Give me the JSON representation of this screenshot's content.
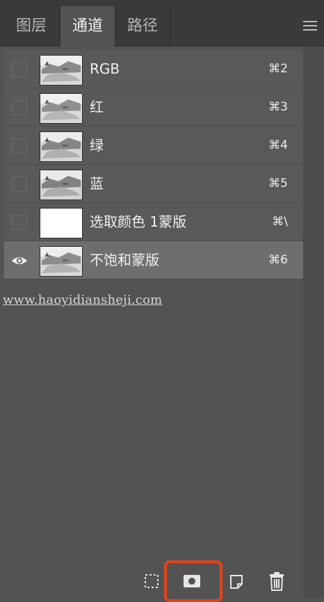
{
  "tabs": [
    {
      "label": "图层",
      "active": false
    },
    {
      "label": "通道",
      "active": true
    },
    {
      "label": "路径",
      "active": false
    }
  ],
  "panel_menu_icon": "hamburger-menu-icon",
  "channels": [
    {
      "name": "RGB",
      "shortcut": "⌘2",
      "visible": false,
      "thumb": "photo"
    },
    {
      "name": "红",
      "shortcut": "⌘3",
      "visible": false,
      "thumb": "photo"
    },
    {
      "name": "绿",
      "shortcut": "⌘4",
      "visible": false,
      "thumb": "photo"
    },
    {
      "name": "蓝",
      "shortcut": "⌘5",
      "visible": false,
      "thumb": "photo"
    },
    {
      "name": "选取颜色 1蒙版",
      "shortcut": "⌘\\",
      "visible": false,
      "thumb": "white"
    },
    {
      "name": "不饱和蒙版",
      "shortcut": "⌘6",
      "visible": true,
      "thumb": "photo",
      "selected": true
    }
  ],
  "watermark": "www.haoyidiansheji.com",
  "toolbar": {
    "icons": [
      "load-selection-icon",
      "save-selection-as-channel-icon",
      "new-channel-icon",
      "delete-channel-icon"
    ],
    "highlight_color": "#e0441c"
  },
  "colors": {
    "panel_bg": "#535353",
    "tabbar_bg": "#3a3a3a",
    "selected_row": "#6e6e6e",
    "row_bg": "#595959"
  }
}
